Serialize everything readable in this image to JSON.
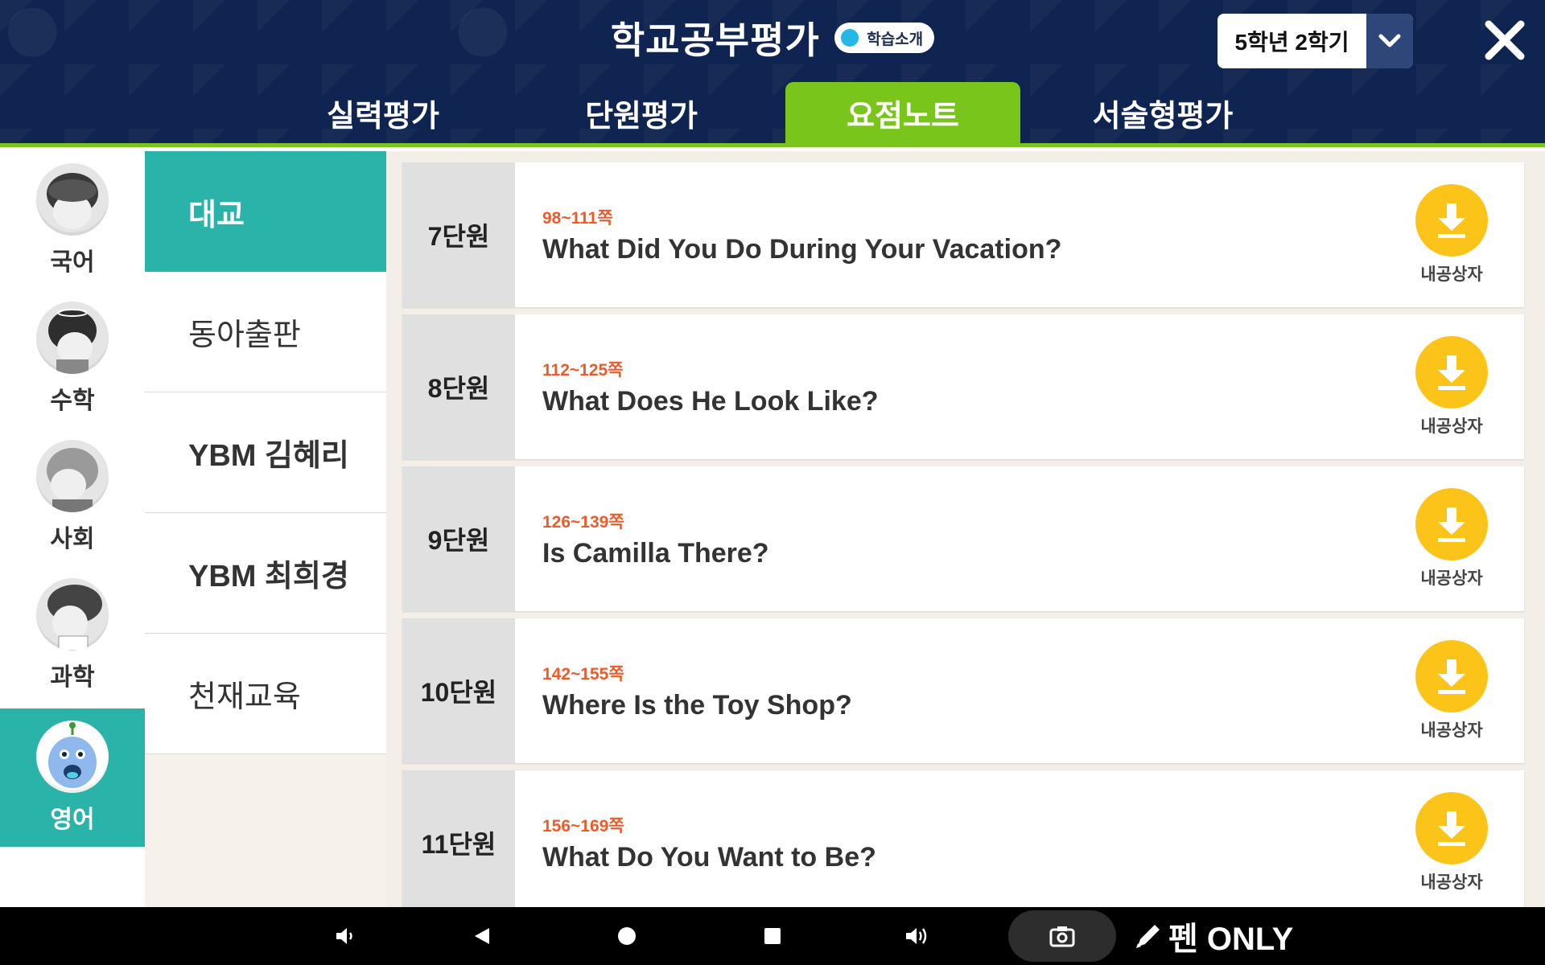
{
  "header": {
    "title": "학교공부평가",
    "intro_button": "학습소개",
    "grade_select": "5학년 2학기",
    "tabs": [
      {
        "label": "실력평가",
        "active": false
      },
      {
        "label": "단원평가",
        "active": false
      },
      {
        "label": "요점노트",
        "active": true
      },
      {
        "label": "서술형평가",
        "active": false
      }
    ]
  },
  "subjects": [
    {
      "label": "국어",
      "active": false
    },
    {
      "label": "수학",
      "active": false
    },
    {
      "label": "사회",
      "active": false
    },
    {
      "label": "과학",
      "active": false
    },
    {
      "label": "영어",
      "active": true
    }
  ],
  "publishers": [
    {
      "label": "대교",
      "active": true
    },
    {
      "label": "동아출판",
      "active": false
    },
    {
      "label": "YBM 김혜리",
      "active": false
    },
    {
      "label": "YBM 최희경",
      "active": false
    },
    {
      "label": "천재교육",
      "active": false
    }
  ],
  "units": [
    {
      "unit": "7단원",
      "pages": "98~111쪽",
      "title": "What Did You Do During Your Vacation?",
      "download_label": "내공상자"
    },
    {
      "unit": "8단원",
      "pages": "112~125쪽",
      "title": "What Does He Look Like?",
      "download_label": "내공상자"
    },
    {
      "unit": "9단원",
      "pages": "126~139쪽",
      "title": "Is Camilla There?",
      "download_label": "내공상자"
    },
    {
      "unit": "10단원",
      "pages": "142~155쪽",
      "title": "Where Is the Toy Shop?",
      "download_label": "내공상자"
    },
    {
      "unit": "11단원",
      "pages": "156~169쪽",
      "title": "What Do You Want to Be?",
      "download_label": "내공상자"
    }
  ],
  "system_bar": {
    "pen_label": "펜 ONLY",
    "icons": [
      "volume-down-icon",
      "back-icon",
      "home-icon",
      "recents-icon",
      "volume-up-icon",
      "camera-icon",
      "pen-icon"
    ]
  },
  "colors": {
    "header_bg": "#0f2450",
    "tab_active": "#79c51b",
    "teal_active": "#2ab3a8",
    "page_orange": "#f05a28",
    "download_yellow": "#fcc419"
  }
}
